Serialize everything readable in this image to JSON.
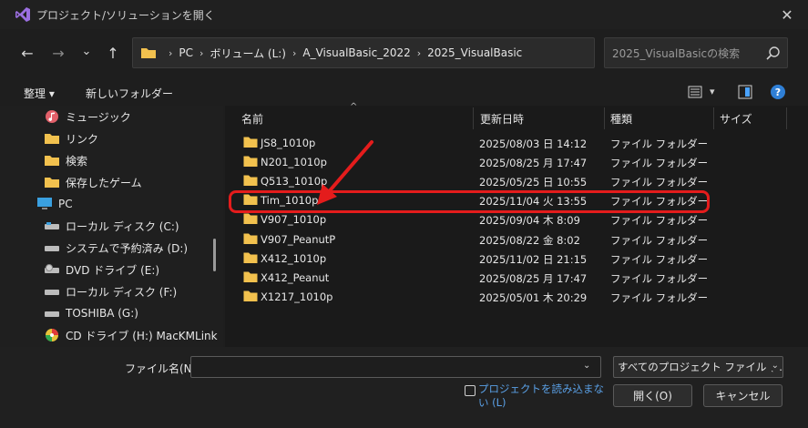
{
  "window": {
    "title": "プロジェクト/ソリューションを開く",
    "close_glyph": "✕"
  },
  "nav": {
    "back_glyph": "←",
    "forward_glyph": "→",
    "recent_glyph": "⌄",
    "up_glyph": "↑"
  },
  "breadcrumb": [
    "PC",
    "ボリューム (L:)",
    "A_VisualBasic_2022",
    "2025_VisualBasic"
  ],
  "breadcrumb_sep": "›",
  "search": {
    "placeholder": "2025_VisualBasicの検索"
  },
  "toolbar": {
    "organize_label": "整理 ▾",
    "new_folder_label": "新しいフォルダー",
    "view_dd": "▾",
    "help_glyph": "?"
  },
  "sidebar": {
    "items": [
      {
        "label": "ミュージック",
        "icon": "music-icon"
      },
      {
        "label": "リンク",
        "icon": "folder-icon"
      },
      {
        "label": "検索",
        "icon": "folder-icon"
      },
      {
        "label": "保存したゲーム",
        "icon": "folder-icon"
      },
      {
        "label": "PC",
        "icon": "pc-icon"
      },
      {
        "label": "ローカル ディスク (C:)",
        "icon": "drive-icon"
      },
      {
        "label": "システムで予約済み (D:)",
        "icon": "drive-icon"
      },
      {
        "label": "DVD ドライブ (E:)",
        "icon": "dvd-icon"
      },
      {
        "label": "ローカル ディスク (F:)",
        "icon": "drive-icon"
      },
      {
        "label": "TOSHIBA (G:)",
        "icon": "usb-drive-icon"
      },
      {
        "label": "CD ドライブ (H:) MacKMLink",
        "icon": "cd-icon"
      }
    ]
  },
  "columns": {
    "name": "名前",
    "date": "更新日時",
    "type": "種類",
    "size": "サイズ",
    "sort_glyph": "^"
  },
  "files": [
    {
      "name": "JS8_1010p",
      "date": "2025/08/03 日 14:12",
      "type": "ファイル フォルダー"
    },
    {
      "name": "N201_1010p",
      "date": "2025/08/25 月 17:47",
      "type": "ファイル フォルダー"
    },
    {
      "name": "Q513_1010p",
      "date": "2025/05/25 日 10:55",
      "type": "ファイル フォルダー"
    },
    {
      "name": "Tim_1010p",
      "date": "2025/11/04 火 13:55",
      "type": "ファイル フォルダー"
    },
    {
      "name": "V907_1010p",
      "date": "2025/09/04 木 8:09",
      "type": "ファイル フォルダー"
    },
    {
      "name": "V907_PeanutP",
      "date": "2025/08/22 金 8:02",
      "type": "ファイル フォルダー"
    },
    {
      "name": "X412_1010p",
      "date": "2025/11/02 日 21:15",
      "type": "ファイル フォルダー"
    },
    {
      "name": "X412_Peanut",
      "date": "2025/08/25 月 17:47",
      "type": "ファイル フォルダー"
    },
    {
      "name": "X1217_1010p",
      "date": "2025/05/01 木 20:29",
      "type": "ファイル フォルダー"
    }
  ],
  "bottom": {
    "filename_label": "ファイル名(N):",
    "filename_value": "",
    "dd_glyph": "⌄",
    "filter_value": "すべてのプロジェクト ファイル (*.sln;*",
    "noload_label": "プロジェクトを読み込まない (L)",
    "open_label": "開く(O)",
    "cancel_label": "キャンセル"
  },
  "colors": {
    "accent_folder": "#f2c14e",
    "annotation_red": "#e41c1c",
    "link_blue": "#5aa0e6"
  }
}
